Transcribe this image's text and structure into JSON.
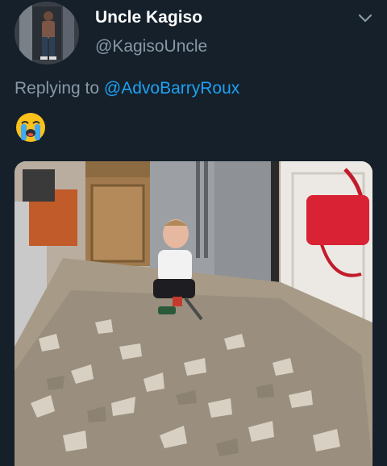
{
  "tweet": {
    "display_name": "Uncle Kagiso",
    "handle": "@KagisoUncle",
    "reply_prefix": "Replying to",
    "reply_to": "@AdvoBarryRoux",
    "emoji": "loudly-crying-face",
    "media_description_icon": "photo"
  },
  "colors": {
    "background": "#15202b",
    "text_primary": "#ffffff",
    "text_secondary": "#8899a6",
    "link": "#1da1f2"
  },
  "icons": {
    "menu": "chevron-down-icon",
    "emoji": "crying-face-icon"
  }
}
